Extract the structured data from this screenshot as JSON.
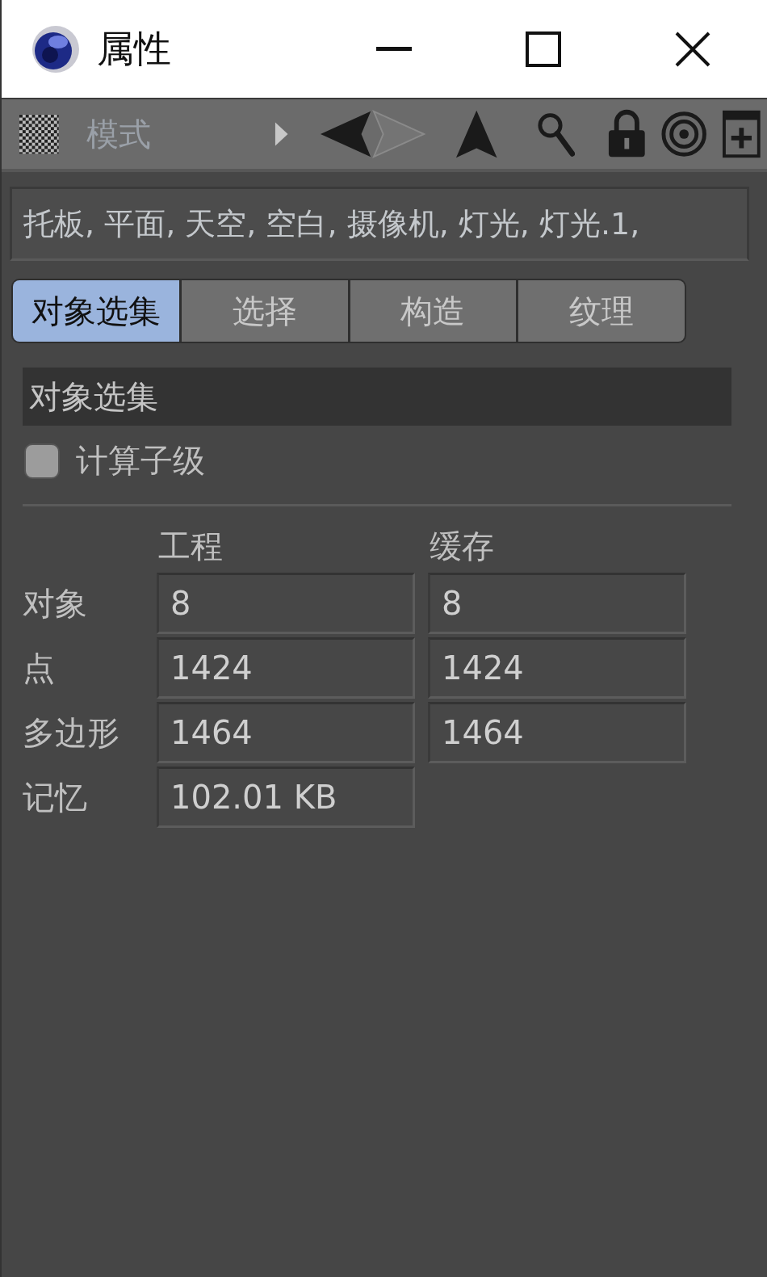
{
  "window": {
    "title": "属性"
  },
  "toolbar": {
    "mode_label": "模式"
  },
  "path_field": {
    "value": "托板, 平面, 天空, 空白, 摄像机, 灯光, 灯光.1,"
  },
  "tabs": [
    {
      "label": "对象选集",
      "selected": true
    },
    {
      "label": "选择",
      "selected": false
    },
    {
      "label": "构造",
      "selected": false
    },
    {
      "label": "纹理",
      "selected": false
    }
  ],
  "section": {
    "title": "对象选集",
    "checkbox": {
      "label": "计算子级",
      "checked": false
    }
  },
  "stats": {
    "columns": [
      "工程",
      "缓存"
    ],
    "rows": [
      {
        "label": "对象",
        "values": [
          "8",
          "8"
        ]
      },
      {
        "label": "点",
        "values": [
          "1424",
          "1424"
        ]
      },
      {
        "label": "多边形",
        "values": [
          "1464",
          "1464"
        ]
      },
      {
        "label": "记忆",
        "values": [
          "102.01 KB"
        ]
      }
    ]
  }
}
